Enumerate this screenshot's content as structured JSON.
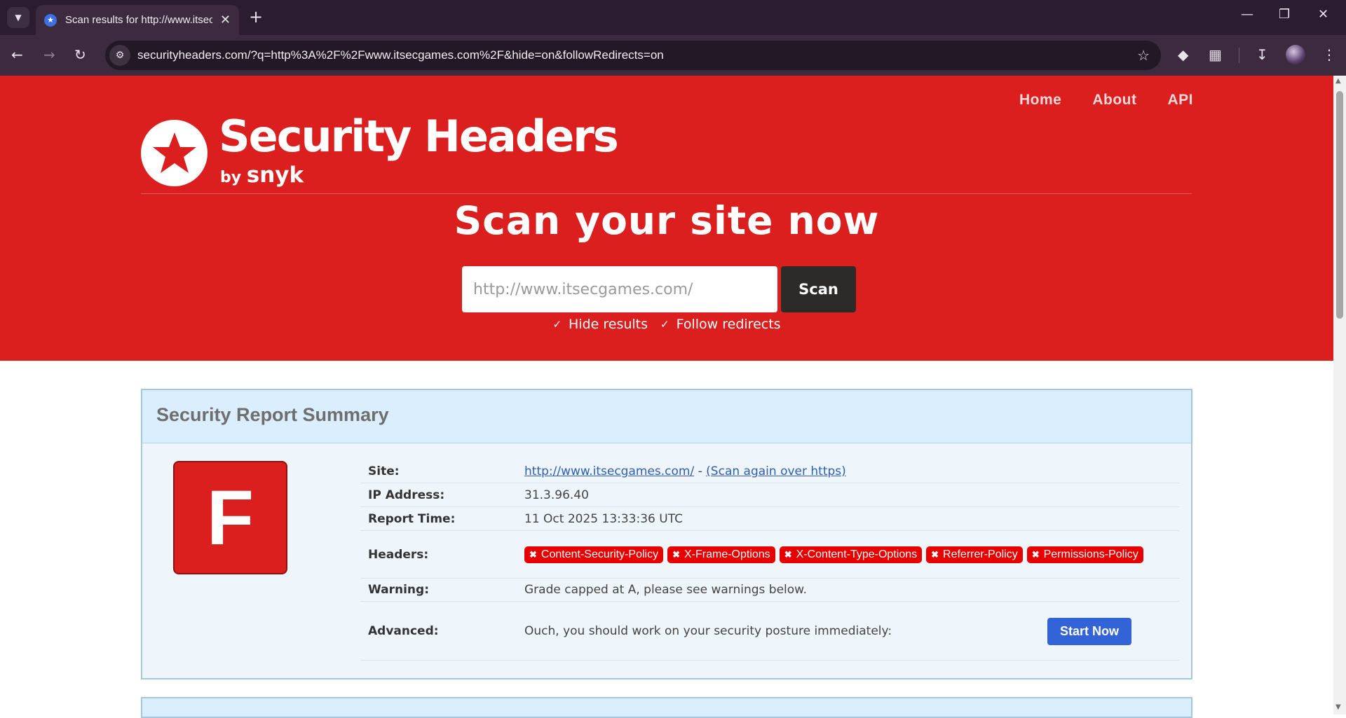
{
  "browser": {
    "tab_title": "Scan results for http://www.itsecgames.com/",
    "url": "securityheaders.com/?q=http%3A%2F%2Fwww.itsecgames.com%2F&hide=on&followRedirects=on"
  },
  "nav": {
    "home": "Home",
    "about": "About",
    "api": "API"
  },
  "logo": {
    "title": "Security Headers",
    "by": "by",
    "brand": "snyk"
  },
  "hero": {
    "title": "Scan your site now",
    "input_placeholder": "http://www.itsecgames.com/",
    "scan_label": "Scan",
    "hide_results": "Hide results",
    "follow_redirects": "Follow redirects"
  },
  "report": {
    "title": "Security Report Summary",
    "grade": "F",
    "grade_color": "#db1f1f",
    "site_label": "Site:",
    "site_link": "http://www.itsecgames.com/",
    "site_sep": " - ",
    "site_rescan": "(Scan again over https)",
    "ip_label": "IP Address:",
    "ip": "31.3.96.40",
    "time_label": "Report Time:",
    "time": "11 Oct 2025 13:33:36 UTC",
    "headers_label": "Headers:",
    "headers": [
      "Content-Security-Policy",
      "X-Frame-Options",
      "X-Content-Type-Options",
      "Referrer-Policy",
      "Permissions-Policy"
    ],
    "warning_label": "Warning:",
    "warning": "Grade capped at A, please see warnings below.",
    "advanced_label": "Advanced:",
    "advanced_text": "Ouch, you should work on your security posture immediately:",
    "start_label": "Start Now"
  }
}
